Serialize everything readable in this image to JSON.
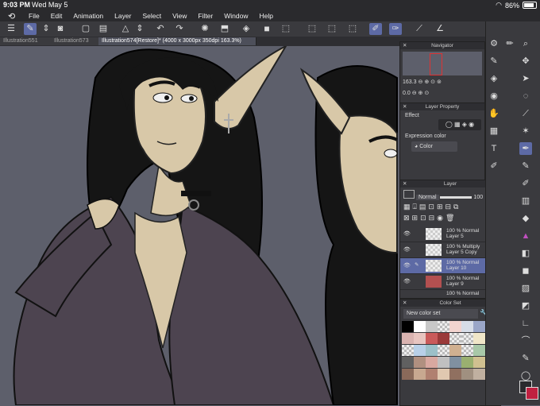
{
  "status": {
    "time": "9:03 PM",
    "date": "Wed May 5",
    "battery": "86%",
    "battery_level": 0.86
  },
  "menu": [
    "File",
    "Edit",
    "Animation",
    "Layer",
    "Select",
    "View",
    "Filter",
    "Window",
    "Help"
  ],
  "tabs": [
    {
      "label": "Illustration551"
    },
    {
      "label": "Illustration573"
    },
    {
      "label": "Illustration574[Restore]* (4000 x 3000px 350dpi 163.3%)"
    }
  ],
  "navigator": {
    "title": "Navigator",
    "zoom": "163.3",
    "rotation": "0.0"
  },
  "layer_property": {
    "title": "Layer Property",
    "effect_label": "Effect",
    "expression_label": "Expression color",
    "expression_value": "Color"
  },
  "layer_panel": {
    "title": "Layer",
    "blend": "Normal",
    "opacity": "100",
    "rows": [
      {
        "opacity": "100 %",
        "blend": "Normal",
        "name": "Layer 5"
      },
      {
        "opacity": "100 %",
        "blend": "Multiply",
        "name": "Layer 5 Copy"
      },
      {
        "opacity": "100 %",
        "blend": "Normal",
        "name": "Layer 10"
      },
      {
        "opacity": "100 %",
        "blend": "Normal",
        "name": "Layer 9"
      },
      {
        "opacity": "100 %",
        "blend": "Normal",
        "name": ""
      }
    ]
  },
  "color_set": {
    "title": "Color Set",
    "set_name": "New color set",
    "swatches": [
      "#000000",
      "#ffffff",
      "#c8c8c8",
      "#transparent",
      "#f2d4cf",
      "#d7dde8",
      "#9aa6c8",
      "#8f95b0",
      "#d9b3b0",
      "#e8c5c0",
      "#c95a5a",
      "#9a3a3a",
      "transparent",
      "transparent",
      "#f0e6c8",
      "#d8c8a0",
      "transparent",
      "#b8d0e8",
      "#9cc0c8",
      "transparent",
      "#d0b090",
      "transparent",
      "#a8c8a8",
      "#e8e0b0",
      "#606060",
      "#b09080",
      "#d8a8a0",
      "#c0c0c0",
      "#8090a0",
      "#9ab070",
      "#d0c090",
      "#b0a880",
      "#8a6a5a",
      "#c8a890",
      "#b08070",
      "#e0c8b0",
      "#907060",
      "#a09080",
      "#c0b0a0",
      "#a8a090"
    ]
  }
}
